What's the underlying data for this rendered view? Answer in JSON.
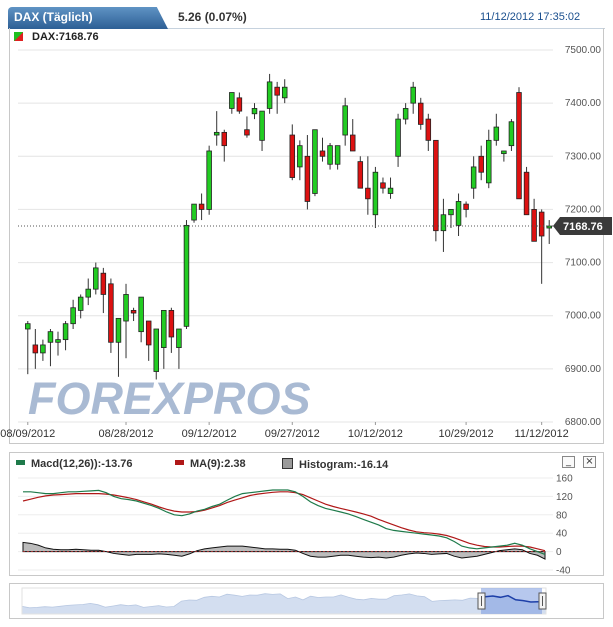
{
  "header": {
    "tab_title": "DAX (Täglich)",
    "change": "5.26 (0.07%)",
    "datetime": "11/12/2012 17:35:02"
  },
  "price_panel": {
    "label": "DAX:7168.76",
    "last_price_label": "7168.76",
    "watermark": "FOREXPROS"
  },
  "macd_panel": {
    "legend": [
      {
        "text": "Macd(12,26)):-13.76",
        "color": "#1e7a4a"
      },
      {
        "text": "MA(9):2.38",
        "color": "#b01818"
      },
      {
        "text": "Histogram:-16.14",
        "color": "#9a9a9a"
      }
    ],
    "minimize_label": "_",
    "close_label": "×"
  },
  "colors": {
    "up": "#22cc22",
    "down": "#dd1111",
    "macd": "#1e7a4a",
    "signal": "#b01818",
    "histogram": "#888888",
    "navigator": "#a9bfe0"
  },
  "chart_data": [
    {
      "type": "candlestick",
      "title": "DAX:7168.76",
      "ylim": [
        6800,
        7500
      ],
      "y_ticks": [
        "7500.00",
        "7400.00",
        "7300.00",
        "7200.00",
        "7100.00",
        "7000.00",
        "6900.00",
        "6800.00"
      ],
      "x_tick_labels": [
        "08/09/2012",
        "08/28/2012",
        "09/12/2012",
        "09/27/2012",
        "10/12/2012",
        "10/29/2012",
        "11/12/2012"
      ],
      "x_tick_index": [
        0,
        13,
        24,
        35,
        46,
        58,
        68
      ],
      "last_value": 7168.76,
      "candles": [
        [
          6975,
          6990,
          6890,
          6985
        ],
        [
          6945,
          6975,
          6900,
          6930
        ],
        [
          6930,
          6955,
          6915,
          6945
        ],
        [
          6950,
          6975,
          6905,
          6970
        ],
        [
          6950,
          6970,
          6925,
          6955
        ],
        [
          6955,
          6990,
          6935,
          6985
        ],
        [
          6985,
          7030,
          6975,
          7015
        ],
        [
          7010,
          7040,
          6995,
          7035
        ],
        [
          7035,
          7070,
          7020,
          7050
        ],
        [
          7050,
          7100,
          7040,
          7090
        ],
        [
          7080,
          7090,
          7005,
          7040
        ],
        [
          7060,
          7070,
          6930,
          6950
        ],
        [
          6950,
          6990,
          6885,
          6995
        ],
        [
          6990,
          7060,
          6920,
          7040
        ],
        [
          7010,
          7015,
          6990,
          7005
        ],
        [
          6970,
          7030,
          6950,
          7035
        ],
        [
          6990,
          6990,
          6915,
          6945
        ],
        [
          6895,
          6975,
          6880,
          6975
        ],
        [
          6940,
          7010,
          6900,
          7010
        ],
        [
          7010,
          7015,
          6930,
          6960
        ],
        [
          6940,
          6970,
          6900,
          6975
        ],
        [
          6980,
          7180,
          6975,
          7170
        ],
        [
          7180,
          7210,
          7175,
          7210
        ],
        [
          7210,
          7230,
          7180,
          7200
        ],
        [
          7200,
          7320,
          7190,
          7310
        ],
        [
          7340,
          7385,
          7320,
          7345
        ],
        [
          7345,
          7350,
          7290,
          7320
        ],
        [
          7390,
          7415,
          7380,
          7420
        ],
        [
          7410,
          7420,
          7380,
          7385
        ],
        [
          7350,
          7375,
          7335,
          7340
        ],
        [
          7380,
          7400,
          7370,
          7390
        ],
        [
          7330,
          7385,
          7310,
          7385
        ],
        [
          7390,
          7455,
          7380,
          7440
        ],
        [
          7430,
          7440,
          7380,
          7415
        ],
        [
          7410,
          7445,
          7400,
          7430
        ],
        [
          7340,
          7360,
          7255,
          7260
        ],
        [
          7280,
          7330,
          7255,
          7320
        ],
        [
          7300,
          7340,
          7200,
          7215
        ],
        [
          7230,
          7350,
          7225,
          7350
        ],
        [
          7310,
          7335,
          7290,
          7300
        ],
        [
          7285,
          7325,
          7275,
          7320
        ],
        [
          7285,
          7320,
          7275,
          7320
        ],
        [
          7340,
          7410,
          7320,
          7395
        ],
        [
          7340,
          7370,
          7320,
          7310
        ],
        [
          7290,
          7300,
          7240,
          7240
        ],
        [
          7240,
          7300,
          7190,
          7220
        ],
        [
          7190,
          7280,
          7165,
          7270
        ],
        [
          7250,
          7260,
          7230,
          7240
        ],
        [
          7230,
          7260,
          7220,
          7240
        ],
        [
          7300,
          7380,
          7280,
          7370
        ],
        [
          7370,
          7400,
          7360,
          7390
        ],
        [
          7400,
          7440,
          7380,
          7430
        ],
        [
          7400,
          7410,
          7350,
          7360
        ],
        [
          7370,
          7380,
          7310,
          7330
        ],
        [
          7330,
          7330,
          7140,
          7160
        ],
        [
          7160,
          7220,
          7120,
          7190
        ],
        [
          7190,
          7200,
          7165,
          7200
        ],
        [
          7170,
          7230,
          7150,
          7215
        ],
        [
          7210,
          7215,
          7185,
          7200
        ],
        [
          7240,
          7300,
          7220,
          7280
        ],
        [
          7300,
          7320,
          7255,
          7270
        ],
        [
          7250,
          7350,
          7240,
          7330
        ],
        [
          7330,
          7380,
          7320,
          7355
        ],
        [
          7305,
          7310,
          7290,
          7310
        ],
        [
          7320,
          7370,
          7310,
          7365
        ],
        [
          7420,
          7430,
          7220,
          7220
        ],
        [
          7270,
          7280,
          7200,
          7190
        ],
        [
          7200,
          7220,
          7140,
          7140
        ],
        [
          7195,
          7200,
          7060,
          7150
        ],
        [
          7165,
          7180,
          7135,
          7168.76
        ]
      ]
    },
    {
      "type": "line",
      "title": "Macd(12,26))",
      "ylim": [
        -40,
        160
      ],
      "y_ticks": [
        "160",
        "120",
        "80",
        "40",
        "0",
        "-40"
      ],
      "series": [
        {
          "name": "Macd(12,26))",
          "values": [
            130,
            130,
            128,
            126,
            126,
            128,
            130,
            130,
            131,
            132,
            133,
            128,
            120,
            115,
            113,
            110,
            105,
            100,
            94,
            86,
            80,
            78,
            82,
            88,
            92,
            98,
            103,
            112,
            120,
            126,
            128,
            130,
            132,
            134,
            134,
            134,
            130,
            120,
            108,
            100,
            94,
            90,
            86,
            82,
            76,
            70,
            64,
            58,
            50,
            46,
            44,
            42,
            40,
            38,
            36,
            34,
            30,
            22,
            12,
            8,
            6,
            8,
            10,
            12,
            14,
            18,
            14,
            6,
            0,
            -6
          ]
        },
        {
          "name": "MA(9)",
          "values": [
            110,
            114,
            118,
            121,
            123,
            124,
            125,
            126,
            126,
            126,
            126,
            125,
            123,
            120,
            117,
            113,
            108,
            103,
            97,
            92,
            88,
            86,
            86,
            87,
            90,
            95,
            100,
            107,
            112,
            117,
            122,
            125,
            127,
            129,
            130,
            130,
            128,
            124,
            117,
            110,
            103,
            98,
            94,
            90,
            86,
            82,
            77,
            70,
            64,
            58,
            52,
            47,
            43,
            41,
            40,
            38,
            35,
            30,
            24,
            18,
            14,
            11,
            10,
            10,
            11,
            12,
            12,
            10,
            6,
            2
          ]
        },
        {
          "name": "Histogram",
          "values": [
            20,
            18,
            14,
            8,
            5,
            4,
            4,
            5,
            4,
            3,
            3,
            0,
            -4,
            -6,
            -8,
            -6,
            -6,
            -6,
            -5,
            -6,
            -8,
            -10,
            -5,
            2,
            6,
            8,
            10,
            12,
            12,
            12,
            10,
            8,
            6,
            6,
            5,
            5,
            3,
            -4,
            -10,
            -12,
            -12,
            -10,
            -8,
            -8,
            -10,
            -12,
            -13,
            -12,
            -14,
            -12,
            -8,
            -5,
            -3,
            -4,
            -6,
            -5,
            -4,
            -10,
            -14,
            -12,
            -10,
            -6,
            -2,
            2,
            4,
            6,
            4,
            -4,
            -8,
            -16.14
          ]
        }
      ]
    }
  ]
}
